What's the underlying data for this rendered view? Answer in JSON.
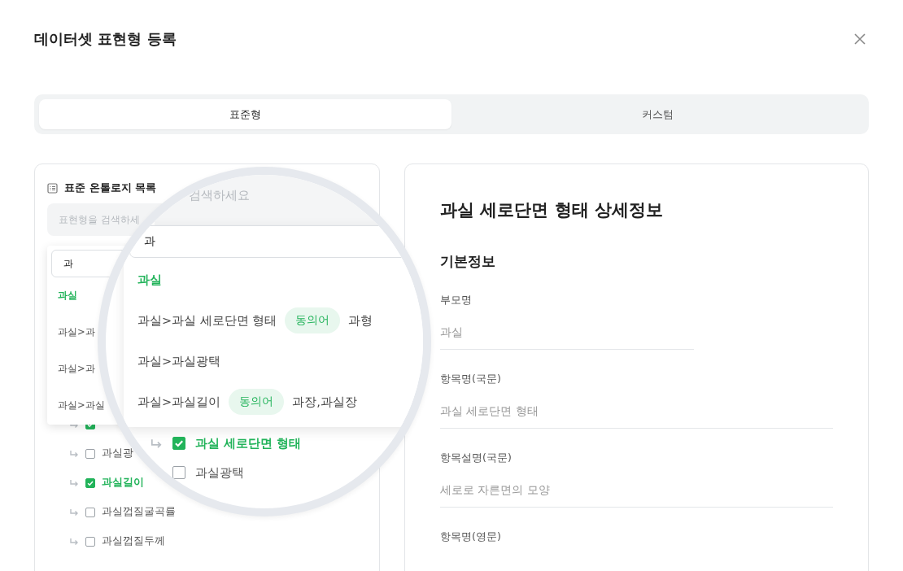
{
  "dialog": {
    "title": "데이터셋 표현형 등록"
  },
  "tabs": [
    {
      "label": "표준형",
      "selected": true
    },
    {
      "label": "커스텀",
      "selected": false
    }
  ],
  "ontology_panel": {
    "title": "표준 온톨로지 목록",
    "search_placeholder": "표현형을 검색하세",
    "dropdown": {
      "query": "과",
      "results": [
        {
          "label": "과실",
          "highlighted": true
        },
        {
          "label": "과실>과",
          "highlighted": false
        },
        {
          "label": "과실>과",
          "highlighted": false
        },
        {
          "label": "과실>과실",
          "highlighted": false
        }
      ]
    },
    "tree": [
      {
        "checked": true
      },
      {
        "label": "과실광",
        "checked": false
      },
      {
        "label": "과실길이",
        "checked": true
      },
      {
        "label": "과실껍질굴곡률",
        "checked": false
      },
      {
        "label": "과실껍질두께",
        "checked": false
      }
    ]
  },
  "magnifier": {
    "search_placeholder": "검색하세요",
    "query": "과",
    "results": [
      {
        "label": "과실",
        "highlighted": true
      },
      {
        "label": "과실>과실 세로단면 형태",
        "highlighted": false,
        "badge": "동의어",
        "synonyms": "과형"
      },
      {
        "label": "과실>과실광택",
        "highlighted": false
      },
      {
        "label": "과실>과실길이",
        "highlighted": false,
        "badge": "동의어",
        "synonyms": "과장,과실장"
      }
    ],
    "tree": [
      {
        "label": "과실 세로단면 형태",
        "checked": true
      },
      {
        "label": "과실광택",
        "checked": false
      }
    ]
  },
  "detail_panel": {
    "title": "과실 세로단면 형태 상세정보",
    "section": "기본정보",
    "fields": [
      {
        "label": "부모명",
        "value": "과실",
        "kind": "short"
      },
      {
        "label": "항목명(국문)",
        "value": "과실 세로단면 형태",
        "kind": "full"
      },
      {
        "label": "항목설명(국문)",
        "value": "세로로 자른면의 모양",
        "kind": "full"
      },
      {
        "label": "항목명(영문)",
        "kind": "full"
      }
    ]
  }
}
